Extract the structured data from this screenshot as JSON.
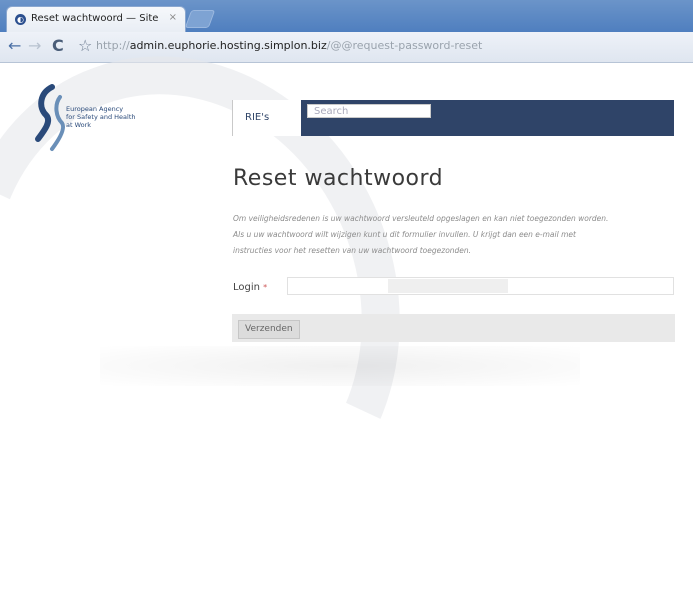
{
  "browser": {
    "tab_title": "Reset wachtwoord — Site",
    "tab_close": "×",
    "url_scheme": "http://",
    "url_host": "admin.euphorie.hosting.simplon.biz",
    "url_path": "/@@request-password-reset",
    "icons": [
      "back-icon",
      "forward-icon",
      "reload-icon",
      "bookmark-star-icon"
    ]
  },
  "logo": {
    "lines": [
      "European Agency",
      "for Safety and Health",
      "at Work"
    ]
  },
  "navbar": {
    "link": "RIE's",
    "search_placeholder": "Search"
  },
  "main": {
    "title": "Reset wachtwoord",
    "intro_lines": [
      "Om veiligheidsredenen is uw wachtwoord versleuteld opgeslagen en kan niet toegezonden worden.",
      "Als u uw wachtwoord wilt wijzigen kunt u dit formulier invullen. U krijgt dan een e-mail met",
      "instructies voor het resetten van uw wachtwoord toegezonden."
    ],
    "login_label": "Login",
    "login_required": "*",
    "submit_label": "Verzenden"
  },
  "colors": {
    "navbar": "#2f4468",
    "chrome": "#4f7fbf"
  }
}
